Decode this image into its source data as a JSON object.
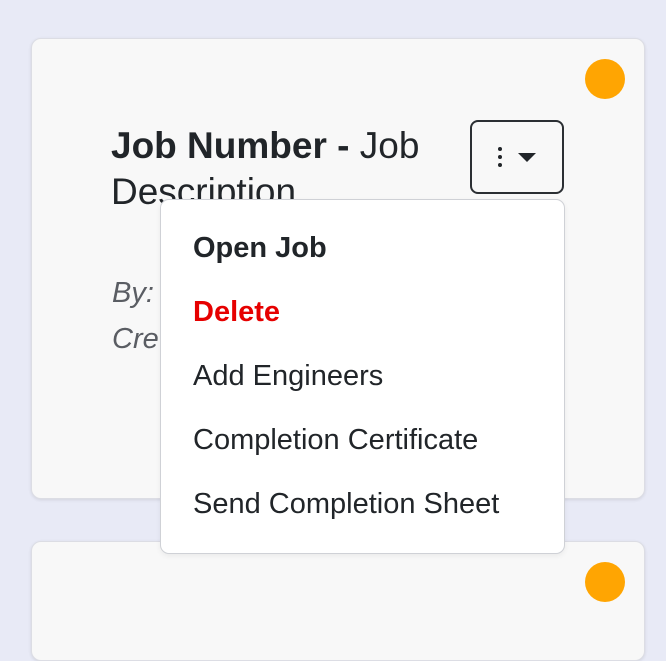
{
  "job_card": {
    "title_number": "Job Number - ",
    "title_description": "Job Description",
    "by_label": "By:",
    "created_label": "Cre",
    "status_color": "#ffa502"
  },
  "actions_menu": {
    "toggle_icons": [
      "kebab-icon",
      "caret-down-icon"
    ],
    "items": [
      {
        "label": "Open Job",
        "style": "bold"
      },
      {
        "label": "Delete",
        "style": "danger",
        "color": "#e60000"
      },
      {
        "label": "Add Engineers"
      },
      {
        "label": "Completion Certificate"
      },
      {
        "label": "Send Completion Sheet"
      }
    ]
  },
  "next_card": {
    "status_color": "#ffa502"
  },
  "colors": {
    "background": "#e8eaf6",
    "card": "#f8f8f8",
    "danger": "#e60000"
  }
}
